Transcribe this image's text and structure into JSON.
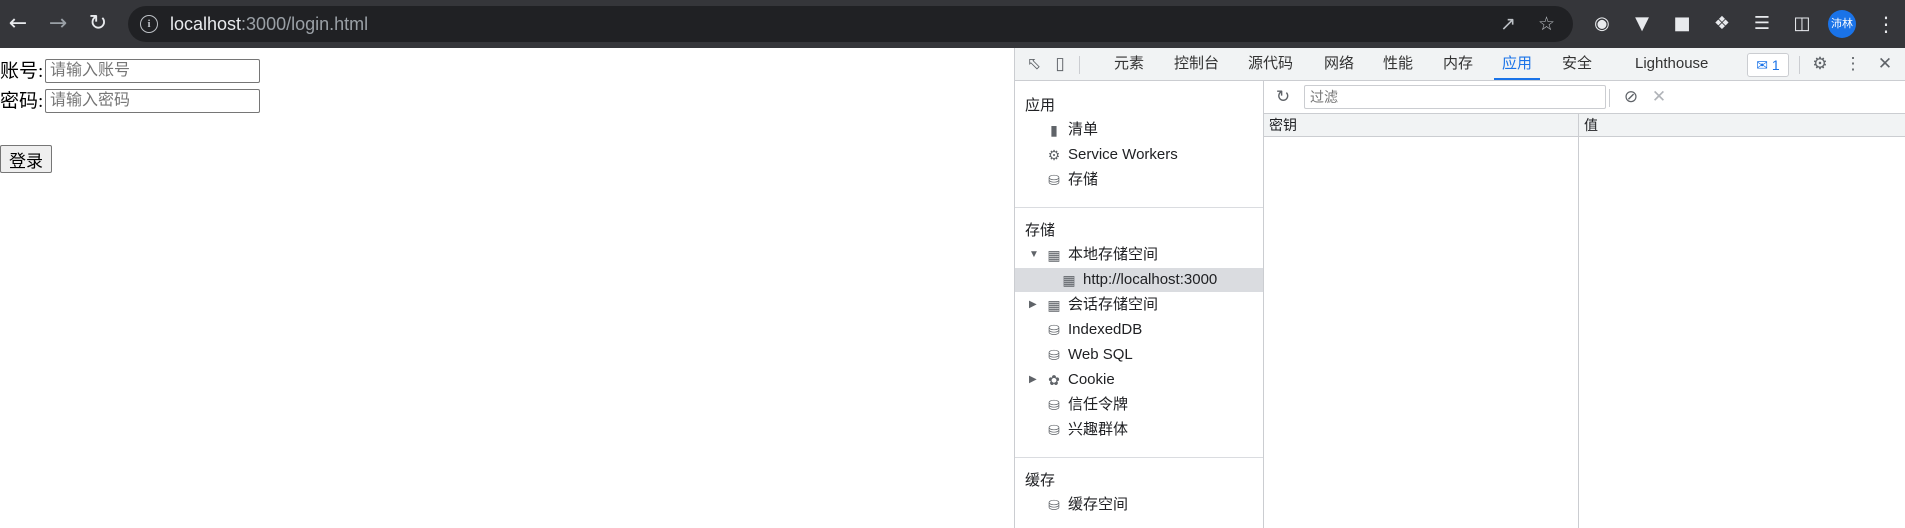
{
  "browser": {
    "url_host": "localhost",
    "url_rest": ":3000/login.html",
    "avatar_text": "沛林"
  },
  "page": {
    "account_label": "账号:",
    "account_placeholder": "请输入账号",
    "password_label": "密码:",
    "password_placeholder": "请输入密码",
    "login_button": "登录"
  },
  "devtools": {
    "tabs": [
      "元素",
      "控制台",
      "源代码",
      "网络",
      "性能",
      "内存",
      "应用",
      "安全",
      "Lighthouse"
    ],
    "active_tab": "应用",
    "issues_count": "1",
    "sidebar": {
      "app_title": "应用",
      "app_items": [
        "清单",
        "Service Workers",
        "存储"
      ],
      "storage_title": "存储",
      "storage_items": [
        "本地存储空间",
        "http://localhost:3000",
        "会话存储空间",
        "IndexedDB",
        "Web SQL",
        "Cookie",
        "信任令牌",
        "兴趣群体"
      ],
      "cache_title": "缓存",
      "cache_items": [
        "缓存空间"
      ]
    },
    "filter_placeholder": "过滤",
    "columns": [
      "密钥",
      "值"
    ]
  },
  "colors": {
    "toolbar_bg": "#35363a",
    "accent": "#1a73e8"
  }
}
